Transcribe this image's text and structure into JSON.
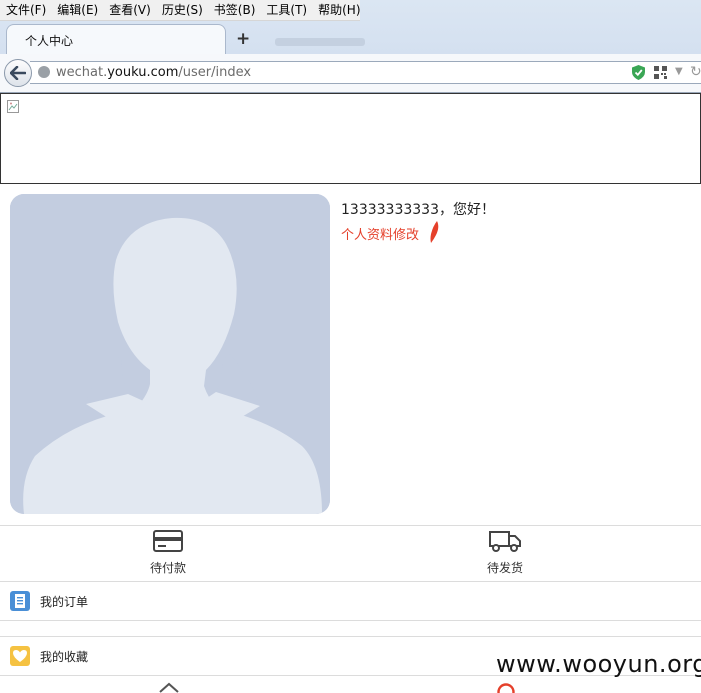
{
  "browser": {
    "menu": [
      "文件(F)",
      "编辑(E)",
      "查看(V)",
      "历史(S)",
      "书签(B)",
      "工具(T)",
      "帮助(H)"
    ],
    "tab_title": "个人中心",
    "new_tab": "+",
    "url_prefix": "wechat.",
    "url_domain": "youku.com",
    "url_path": "/user/index"
  },
  "profile": {
    "greeting": "13333333333，您好！",
    "edit_label": "个人资料修改"
  },
  "order_status": [
    {
      "label": "待付款",
      "icon": "card-icon"
    },
    {
      "label": "待发货",
      "icon": "truck-icon"
    }
  ],
  "menu_list": [
    {
      "label": "我的订单",
      "icon": "document-icon",
      "color": "#4a8fd6"
    },
    {
      "label": "我的收藏",
      "icon": "heart-icon",
      "color": "#f5c242"
    }
  ],
  "watermark": "www.wooyun.org",
  "colors": {
    "accent": "#e5402b",
    "avatar_bg": "#c3cde0"
  }
}
